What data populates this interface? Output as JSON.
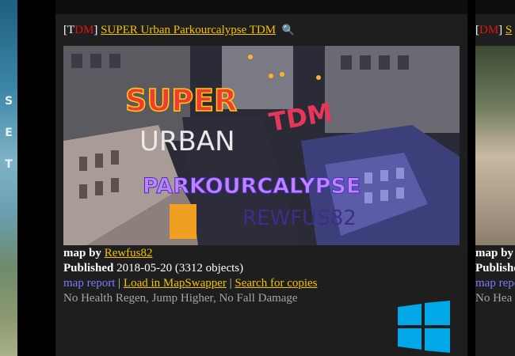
{
  "card": {
    "tag_open": "[",
    "tag_t": "T",
    "tag_dm": "DM",
    "tag_close": "]",
    "title": "SUPER Urban Parkourcalypse TDM",
    "thumbnail_lines": [
      "SUPER",
      "TDM",
      "URBAN",
      "PARKOURCALYPSE",
      "REWFUS82"
    ],
    "map_by_label": "map by",
    "author": "Rewfus82",
    "published_label": "Published",
    "published_date": "2018-05-20",
    "object_count": "(3312 objects)",
    "map_report": "map report",
    "load_mapswapper": "Load in MapSwapper",
    "search_copies": "Search for copies",
    "separator": "|",
    "tags": "No Health Regen, Jump Higher, No Fall Damage",
    "platform_icon": "windows-icon"
  },
  "card2": {
    "tag_open": "[",
    "tag_dm": "DM",
    "tag_close": "]",
    "title": "S",
    "map_by_label": "map by",
    "published_label": "Publishe",
    "map_report": "map repo",
    "tags": "No Hea"
  },
  "colors": {
    "link_yellow": "#f2c200",
    "link_blue": "#7b7bff",
    "tag_red": "#e01515",
    "card_bg": "#1e1e1e",
    "windows_blue": "#00a8e8"
  }
}
